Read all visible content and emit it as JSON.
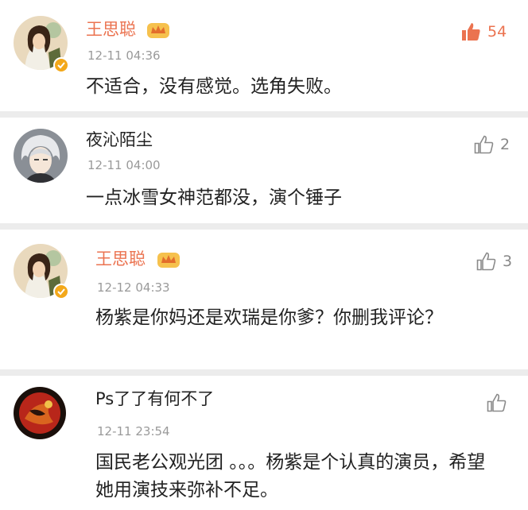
{
  "comments": [
    {
      "username": "王思聪",
      "timestamp": "12-11 04:36",
      "text": "不适合，没有感觉。选角失败。",
      "likes": "54",
      "liked": true,
      "vip": true,
      "avatar_icon": "cartoon-woman-avatar"
    },
    {
      "username": "夜沁陌尘",
      "timestamp": "12-11 04:00",
      "text": "一点冰雪女神范都没，演个锤子",
      "likes": "2",
      "liked": false,
      "vip": false,
      "avatar_icon": "anime-silver-hair-avatar"
    },
    {
      "username": "王思聪",
      "timestamp": "12-12 04:33",
      "text": "杨紫是你妈还是欢瑞是你爹？你删我评论？",
      "likes": "3",
      "liked": false,
      "vip": true,
      "avatar_icon": "cartoon-woman-avatar"
    },
    {
      "username": "Ps了了有何不了",
      "timestamp": "12-11 23:54",
      "text": "国民老公观光团 。。。杨紫是个认真的演员，希望她用演技来弥补不足。",
      "likes": "",
      "liked": false,
      "vip": false,
      "avatar_icon": "red-abstract-avatar"
    }
  ],
  "colors": {
    "vip_name": "#eb7350",
    "like_active": "#eb7350",
    "like_inactive": "#888888",
    "timestamp": "#9a9a9a",
    "badge": "#f3a81a"
  }
}
